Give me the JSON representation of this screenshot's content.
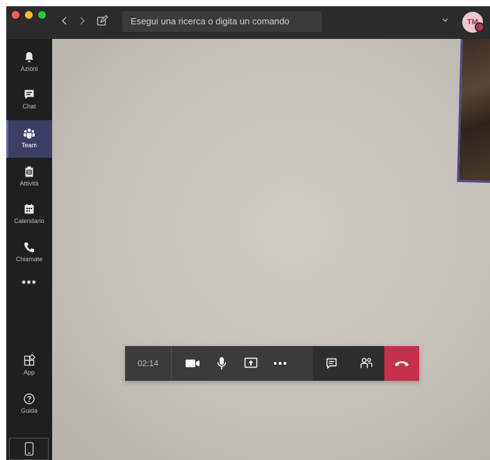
{
  "titlebar": {
    "search_placeholder": "Esegui una ricerca o digita un comando",
    "avatar_initials": "TM"
  },
  "rail": {
    "items": [
      {
        "label": "Azioni",
        "icon": "bell-icon"
      },
      {
        "label": "Chat",
        "icon": "chat-icon"
      },
      {
        "label": "Team",
        "icon": "team-icon"
      },
      {
        "label": "Attività",
        "icon": "assignments-icon"
      },
      {
        "label": "Calendario",
        "icon": "calendar-icon"
      },
      {
        "label": "Chiamate",
        "icon": "phone-icon"
      }
    ],
    "more": "•••",
    "bottom": [
      {
        "label": "App",
        "icon": "apps-icon"
      },
      {
        "label": "Guida",
        "icon": "help-icon"
      }
    ],
    "active": "Team"
  },
  "call": {
    "timer": "02:14",
    "controls": [
      "camera-icon",
      "microphone-icon",
      "share-screen-icon",
      "more-icon",
      "chat-icon",
      "participants-icon",
      "hang-up-icon"
    ]
  },
  "colors": {
    "accent": "#6264a7",
    "hangup": "#c4314b",
    "rail_active": "#3d3e66"
  }
}
